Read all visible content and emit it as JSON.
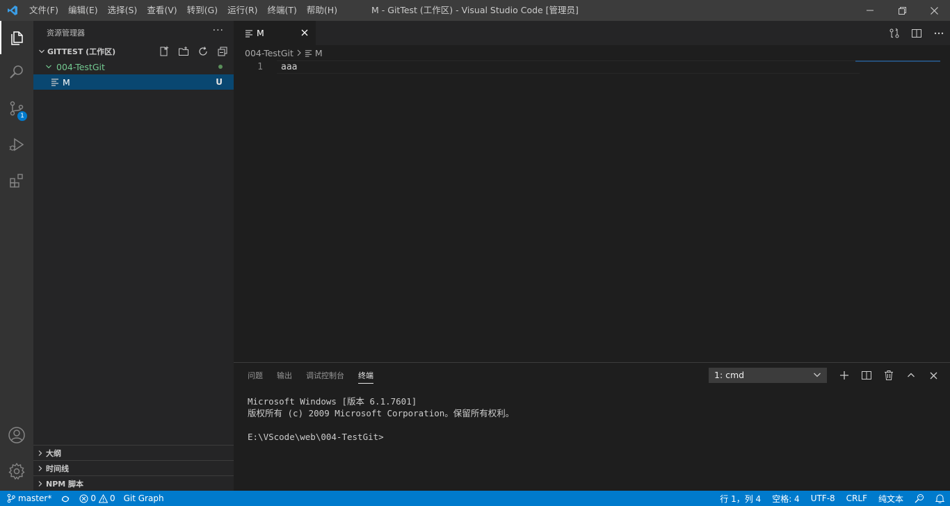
{
  "titlebar": {
    "menus": [
      "文件(F)",
      "编辑(E)",
      "选择(S)",
      "查看(V)",
      "转到(G)",
      "运行(R)",
      "终端(T)",
      "帮助(H)"
    ],
    "window_title": "M - GitTest (工作区) - Visual Studio Code [管理员]"
  },
  "activitybar": {
    "scm_badge": "1"
  },
  "sidebar": {
    "title": "资源管理器",
    "more": "···",
    "workspace": "GITTEST (工作区)",
    "folder": "004-TestGit",
    "file": "M",
    "file_status": "U",
    "panes": [
      "大纲",
      "时间线",
      "NPM 脚本"
    ]
  },
  "editor": {
    "tab_label": "M",
    "breadcrumb_folder": "004-TestGit",
    "breadcrumb_file": "M",
    "line_number": "1",
    "line_text": "aaa"
  },
  "panel": {
    "tabs": [
      "问题",
      "输出",
      "调试控制台",
      "终端"
    ],
    "active_tab": "终端",
    "terminal_select": "1: cmd",
    "terminal_lines": [
      "Microsoft Windows [版本 6.1.7601]",
      "版权所有 (c) 2009 Microsoft Corporation。保留所有权利。",
      "",
      "E:\\VScode\\web\\004-TestGit>"
    ]
  },
  "statusbar": {
    "branch": "master*",
    "errors": "0",
    "warnings": "0",
    "git_graph": "Git Graph",
    "position": "行 1，列 4",
    "spaces": "空格: 4",
    "encoding": "UTF-8",
    "eol": "CRLF",
    "language": "纯文本"
  },
  "colors": {
    "accent": "#007acc",
    "selection": "#094771",
    "folder_green": "#73c991"
  }
}
